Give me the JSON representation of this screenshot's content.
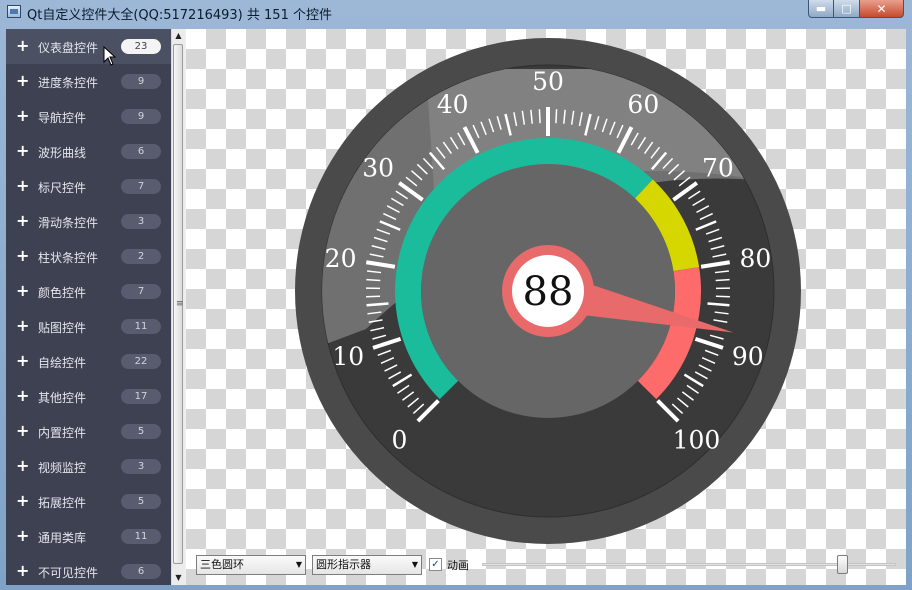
{
  "window": {
    "title": "Qt自定义控件大全(QQ:517216493) 共 151 个控件",
    "btn_min": "▬",
    "btn_max": "□",
    "btn_close": "✕"
  },
  "sidebar": {
    "items": [
      {
        "label": "仪表盘控件",
        "count": "23",
        "active": true
      },
      {
        "label": "进度条控件",
        "count": "9"
      },
      {
        "label": "导航控件",
        "count": "9"
      },
      {
        "label": "波形曲线",
        "count": "6"
      },
      {
        "label": "标尺控件",
        "count": "7"
      },
      {
        "label": "滑动条控件",
        "count": "3"
      },
      {
        "label": "柱状条控件",
        "count": "2"
      },
      {
        "label": "颜色控件",
        "count": "7"
      },
      {
        "label": "贴图控件",
        "count": "11"
      },
      {
        "label": "自绘控件",
        "count": "22"
      },
      {
        "label": "其他控件",
        "count": "17"
      },
      {
        "label": "内置控件",
        "count": "5"
      },
      {
        "label": "视频监控",
        "count": "3"
      },
      {
        "label": "拓展控件",
        "count": "5"
      },
      {
        "label": "通用类库",
        "count": "11"
      },
      {
        "label": "不可见控件",
        "count": "6"
      }
    ],
    "plus_glyph": "+"
  },
  "scrollbar": {
    "up": "▲",
    "down": "▼",
    "grip": "≡"
  },
  "gauge": {
    "value": 88,
    "min": 0,
    "max": 100,
    "tick_labels": [
      "0",
      "10",
      "20",
      "30",
      "40",
      "50",
      "60",
      "70",
      "80",
      "90",
      "100"
    ],
    "ranges": [
      {
        "from": 0,
        "to": 66,
        "color": "#1abc9c"
      },
      {
        "from": 66,
        "to": 80,
        "color": "#d6d600"
      },
      {
        "from": 80,
        "to": 100,
        "color": "#fd6b6b"
      }
    ],
    "colors": {
      "outer_ring": "#4a4a4a",
      "face": "#3a3a3a",
      "inner_disc": "#666666",
      "pointer": "#e86a6a",
      "center_ring": "#e86a6a",
      "center_fill": "#ffffff",
      "scale": "#ffffff"
    }
  },
  "controls": {
    "ring_style": "三色圆环",
    "pointer_style": "圆形指示器",
    "combo_arrow": "▼",
    "animation_label": "动画",
    "animation_checked": true,
    "check_glyph": "✓",
    "slider_value": 88
  }
}
